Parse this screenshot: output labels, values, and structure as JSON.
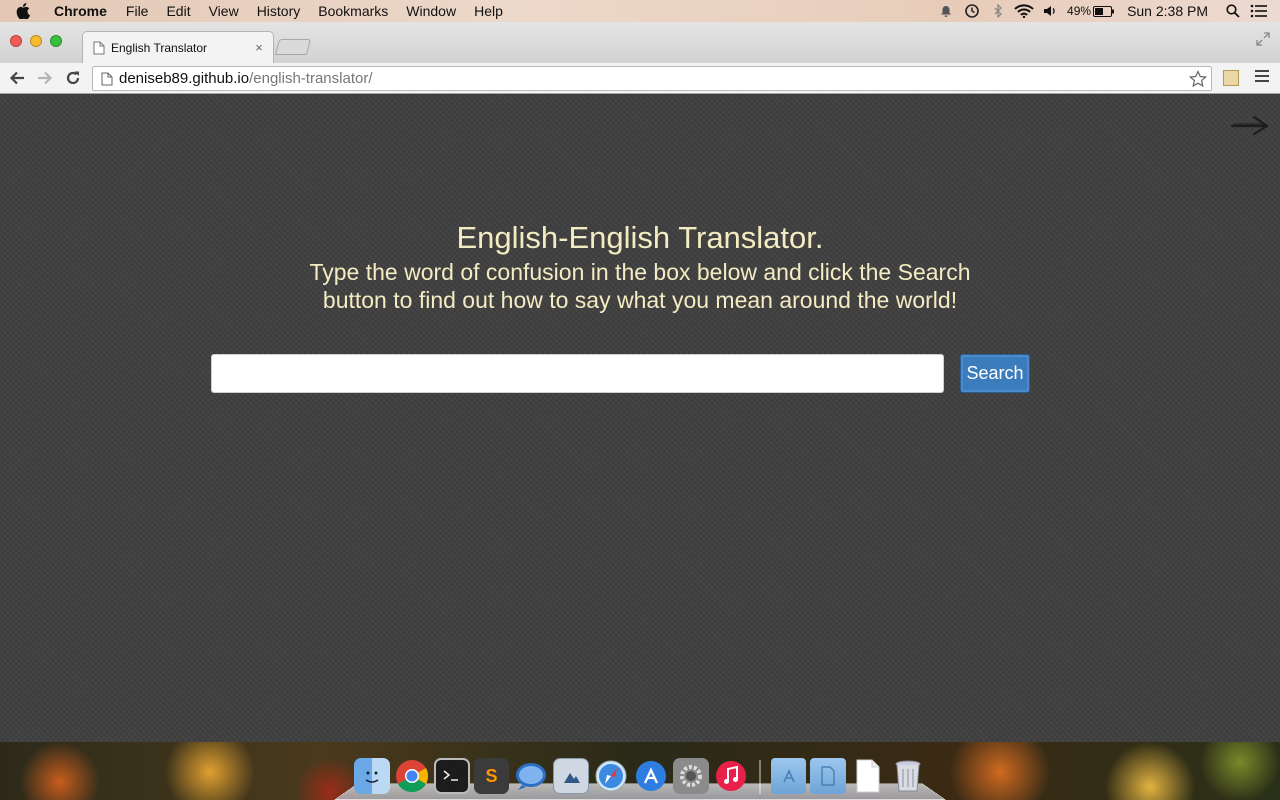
{
  "menubar": {
    "app_name": "Chrome",
    "items": [
      "File",
      "Edit",
      "View",
      "History",
      "Bookmarks",
      "Window",
      "Help"
    ],
    "battery": "49%",
    "clock": "Sun 2:38 PM"
  },
  "browser": {
    "tab_title": "English Translator",
    "tab_close": "×",
    "url_host": "deniseb89.github.io",
    "url_path": "/english-translator/"
  },
  "page": {
    "title": "English-English Translator.",
    "instructions": "Type the word of confusion in the box below and click the Search button to find out how to say what you mean around the world!",
    "search_input_value": "",
    "search_input_placeholder": "",
    "search_button_label": "Search"
  },
  "dock": {
    "apps": [
      "finder-icon",
      "chrome-icon",
      "terminal-icon",
      "sublime-text-icon",
      "messages-icon",
      "preview-icon",
      "safari-icon",
      "app-store-icon",
      "system-preferences-icon",
      "itunes-icon"
    ],
    "folders": [
      "applications-folder-icon",
      "documents-folder-icon",
      "document-icon",
      "trash-icon"
    ]
  }
}
